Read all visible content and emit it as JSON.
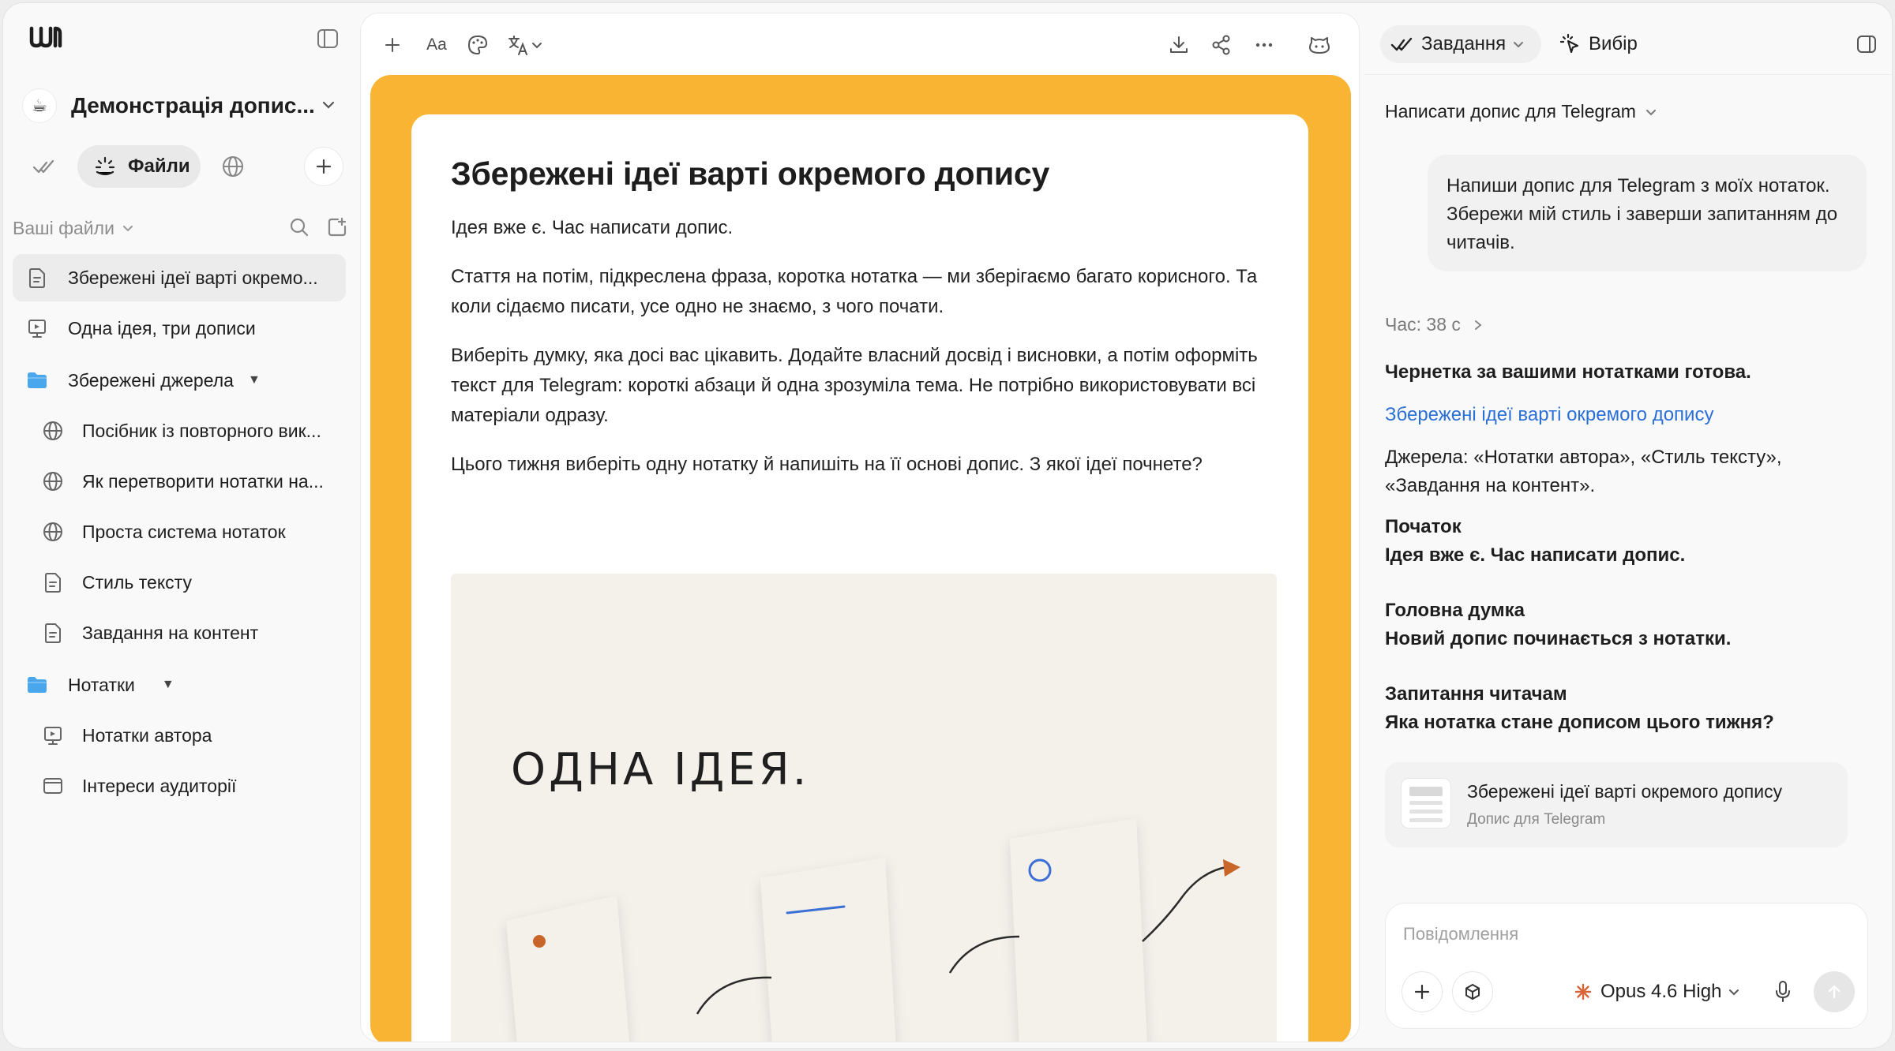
{
  "sidebar": {
    "workspace": {
      "name": "Демонстрація допис...",
      "avatar": "☕"
    },
    "tabs": {
      "files_label": "Файли"
    },
    "files_header": "Ваші файли",
    "items": [
      {
        "label": "Збережені ідеї варті окремо...",
        "icon": "doc-icon",
        "active": true
      },
      {
        "label": "Одна ідея, три дописи",
        "icon": "presentation-icon"
      },
      {
        "label": "Збережені джерела",
        "icon": "folder-icon",
        "folder": true
      },
      {
        "label": "Посібник із повторного вик...",
        "icon": "globe-icon"
      },
      {
        "label": "Як перетворити нотатки на...",
        "icon": "globe-icon"
      },
      {
        "label": "Проста система нотаток",
        "icon": "globe-icon"
      },
      {
        "label": "Стиль тексту",
        "icon": "doc-icon"
      },
      {
        "label": "Завдання на контент",
        "icon": "doc-icon"
      },
      {
        "label": "Нотатки",
        "icon": "folder-icon",
        "folder": true
      },
      {
        "label": "Нотатки автора",
        "icon": "presentation-icon"
      },
      {
        "label": "Інтереси аудиторії",
        "icon": "window-icon"
      }
    ]
  },
  "toolbar": {
    "font_label": "Aa"
  },
  "document": {
    "title": "Збережені ідеї варті окремого допису",
    "paragraphs": [
      "Ідея вже є. Час написати допис.",
      "Стаття на потім, підкреслена фраза, коротка нотатка — ми зберігаємо багато корисного. Та коли сідаємо писати, усе одно не знаємо, з чого почати.",
      "Виберіть думку, яка досі вас цікавить. Додайте власний досвід і висновки, а потім оформіть текст для Telegram: короткі абзаци й одна зрозуміла тема. Не потрібно використовувати всі матеріали одразу.",
      "Цього тижня виберіть одну нотатку й напишіть на її основі допис. З якої ідеї почнете?"
    ],
    "illustration_text": "ОДНА ІДЕЯ."
  },
  "assistant": {
    "task_label": "Завдання",
    "choice_label": "Вибір",
    "thread_title": "Написати допис для Telegram",
    "user_message": "Напиши допис для Telegram з моїх нотаток. Збережи мій стиль і заверши запитанням до читачів.",
    "time_label": "Час: 38 с",
    "response": {
      "intro": "Чернетка за вашими нотатками готова.",
      "link": "Збережені ідеї варті окремого допису",
      "sources": "Джерела: «Нотатки автора», «Стиль тексту», «Завдання на контент».",
      "sections": [
        {
          "heading": "Початок",
          "text": "Ідея вже є. Час написати допис."
        },
        {
          "heading": "Головна думка",
          "text": "Новий допис починається з нотатки."
        },
        {
          "heading": "Запитання читачам",
          "text": "Яка нотатка стане дописом цього тижня?"
        }
      ]
    },
    "reference_card": {
      "title": "Збережені ідеї варті окремого допису",
      "subtitle": "Допис для Telegram"
    },
    "composer": {
      "placeholder": "Повідомлення",
      "model": "Opus 4.6 High"
    }
  },
  "colors": {
    "canvas": "#f9b434",
    "link": "#2a6fd6",
    "accent_orange": "#c8662a",
    "accent_blue": "#3b6fd6"
  }
}
